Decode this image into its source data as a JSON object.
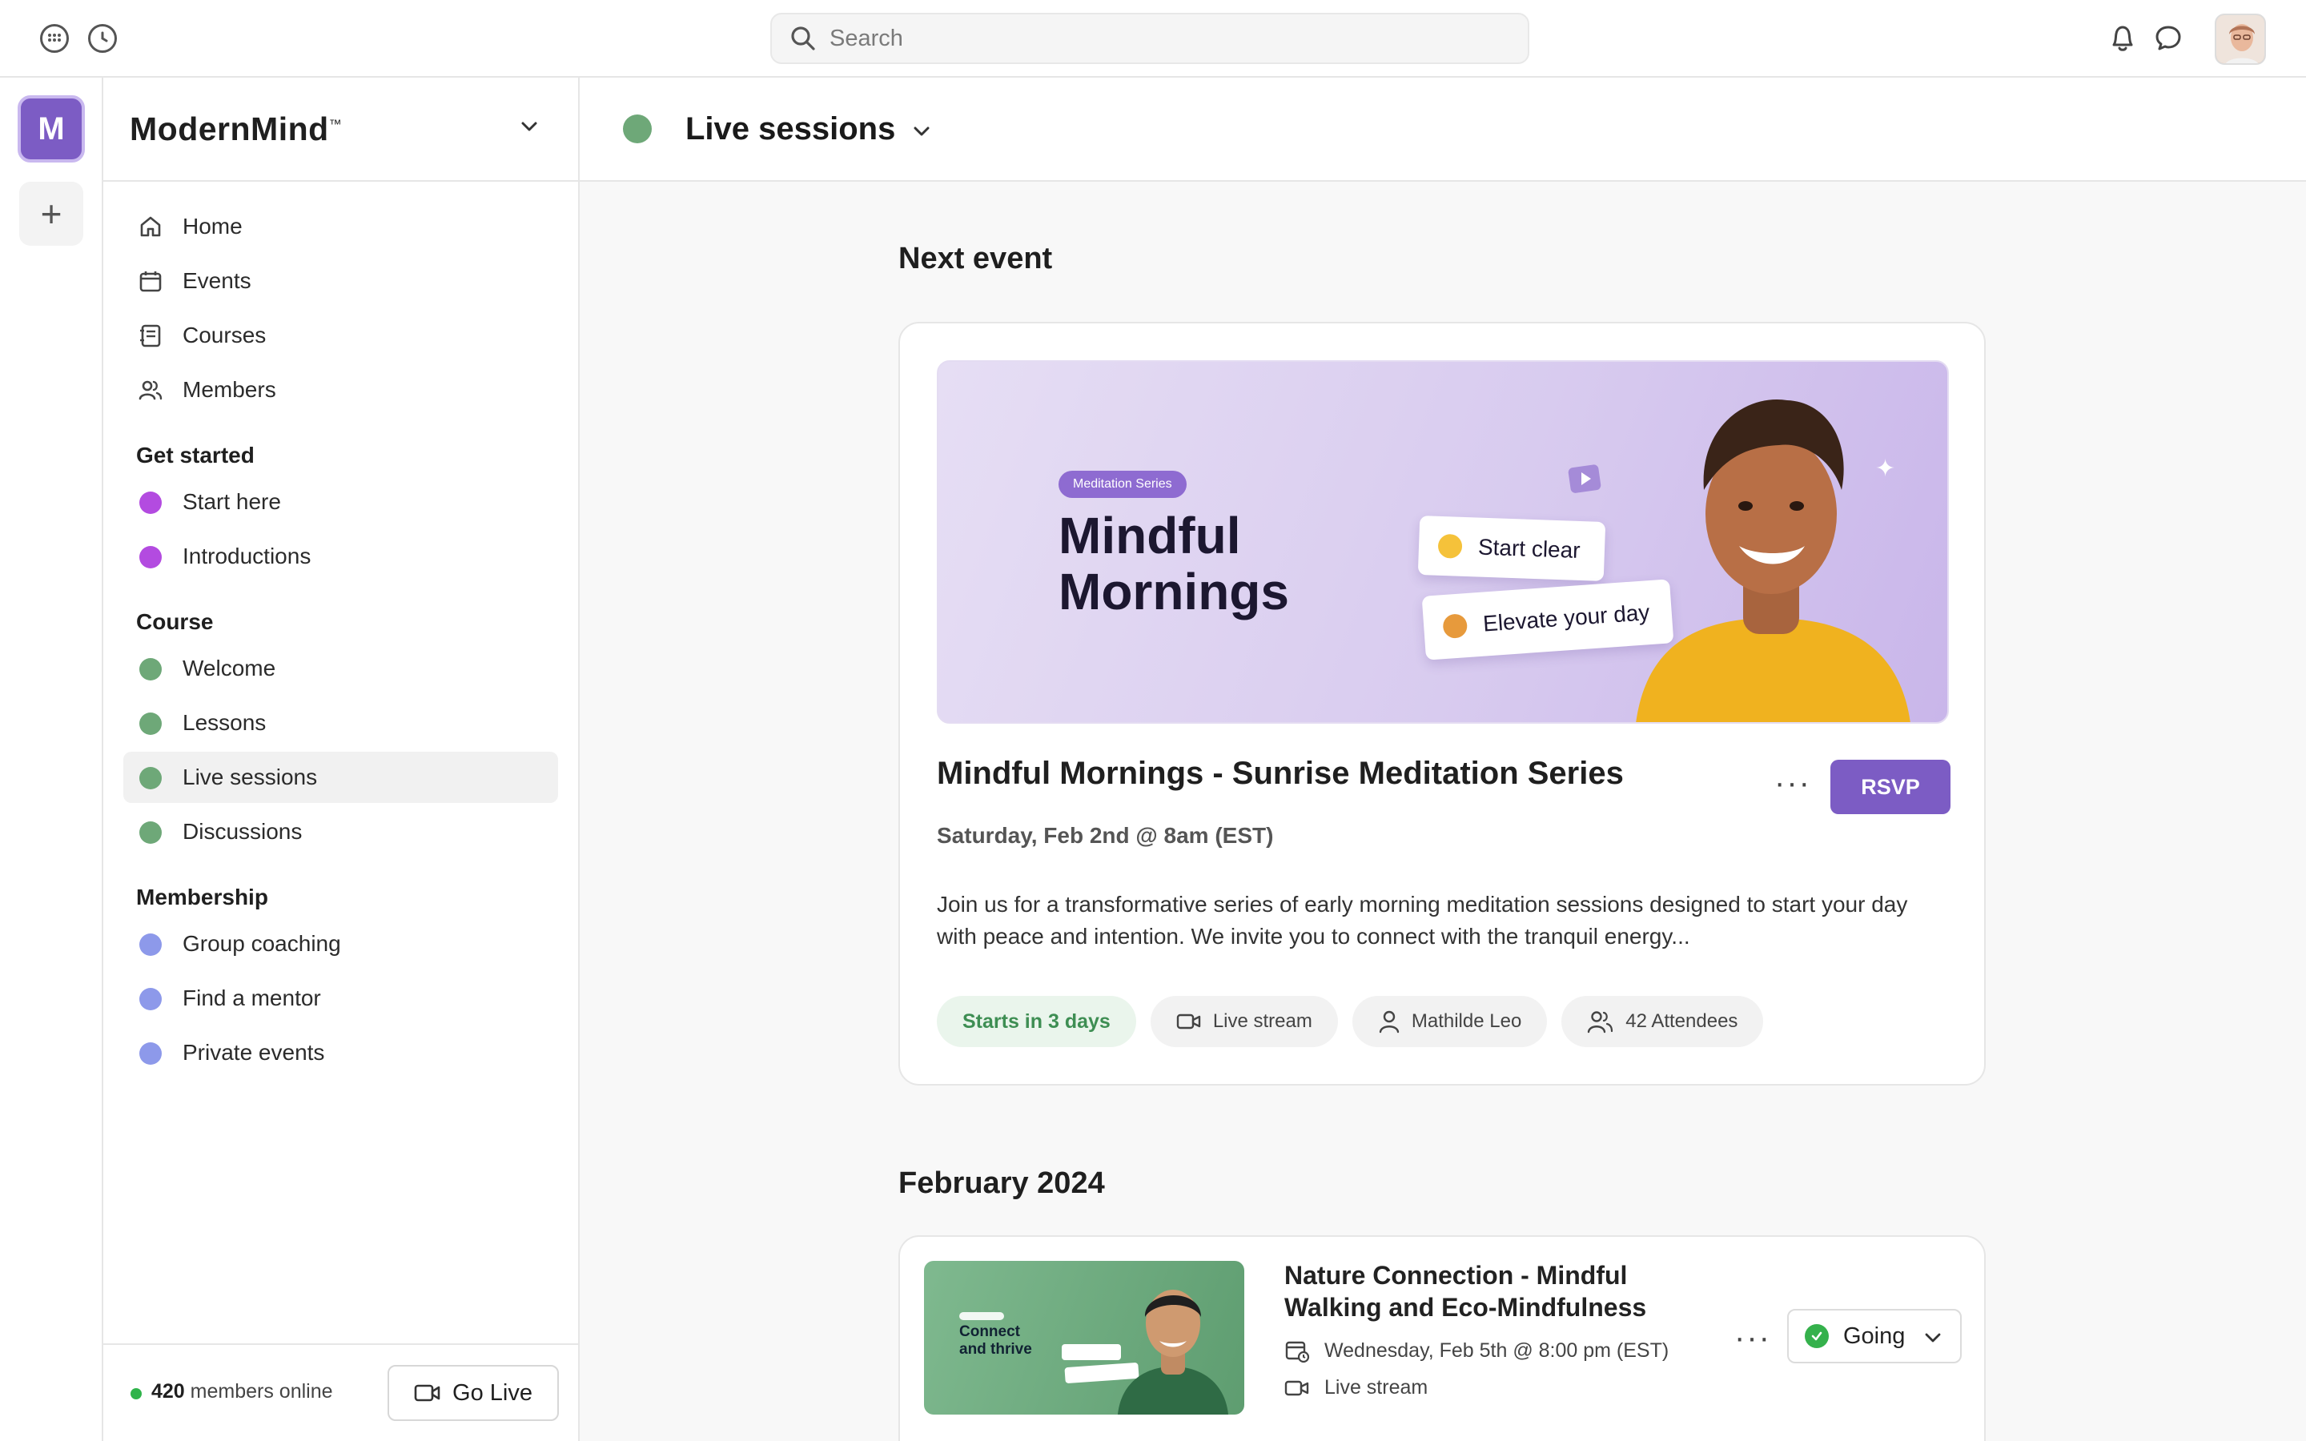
{
  "topbar": {
    "search_placeholder": "Search"
  },
  "rail": {
    "community_initial": "M",
    "add_label": "+"
  },
  "sidebar": {
    "brand": "ModernMind",
    "brand_mark": "™",
    "nav": [
      {
        "label": "Home",
        "icon": "home-icon"
      },
      {
        "label": "Events",
        "icon": "calendar-icon"
      },
      {
        "label": "Courses",
        "icon": "courses-icon"
      },
      {
        "label": "Members",
        "icon": "members-icon"
      }
    ],
    "sections": [
      {
        "title": "Get started",
        "items": [
          {
            "label": "Start here",
            "color": "#b34be0"
          },
          {
            "label": "Introductions",
            "color": "#b34be0"
          }
        ]
      },
      {
        "title": "Course",
        "items": [
          {
            "label": "Welcome",
            "color": "#6ea878"
          },
          {
            "label": "Lessons",
            "color": "#6ea878"
          },
          {
            "label": "Live sessions",
            "color": "#6ea878",
            "active": true
          },
          {
            "label": "Discussions",
            "color": "#6ea878"
          }
        ]
      },
      {
        "title": "Membership",
        "items": [
          {
            "label": "Group coaching",
            "color": "#8d99ea"
          },
          {
            "label": "Find a mentor",
            "color": "#8d99ea"
          },
          {
            "label": "Private events",
            "color": "#8d99ea"
          }
        ]
      }
    ],
    "footer": {
      "online_count": "420",
      "online_suffix": "members online",
      "go_live": "Go Live"
    }
  },
  "main": {
    "title": "Live sessions",
    "accent": "#7c5cc4",
    "next_event_heading": "Next event",
    "next_event": {
      "banner": {
        "chip": "Meditation Series",
        "title_line1": "Mindful",
        "title_line2": "Mornings",
        "pill1": "Start clear",
        "pill2": "Elevate your day"
      },
      "title": "Mindful Mornings - Sunrise Meditation Series",
      "rsvp": "RSVP",
      "more": "···",
      "date": "Saturday, Feb 2nd @ 8am (EST)",
      "description": "Join us for a transformative series of early morning meditation sessions designed to start your day with peace and intention. We invite you to connect with the tranquil energy...",
      "chips": {
        "starts": "Starts in 3 days",
        "format": "Live stream",
        "host": "Mathilde Leo",
        "attendees": "42 Attendees"
      }
    },
    "month_heading": "February 2024",
    "events": [
      {
        "thumb_title_line1": "Connect",
        "thumb_title_line2": "and thrive",
        "title": "Nature Connection - Mindful Walking and Eco-Mindfulness",
        "date": "Wednesday, Feb 5th @ 8:00 pm (EST)",
        "format": "Live stream",
        "more": "···",
        "status": "Going"
      }
    ]
  }
}
